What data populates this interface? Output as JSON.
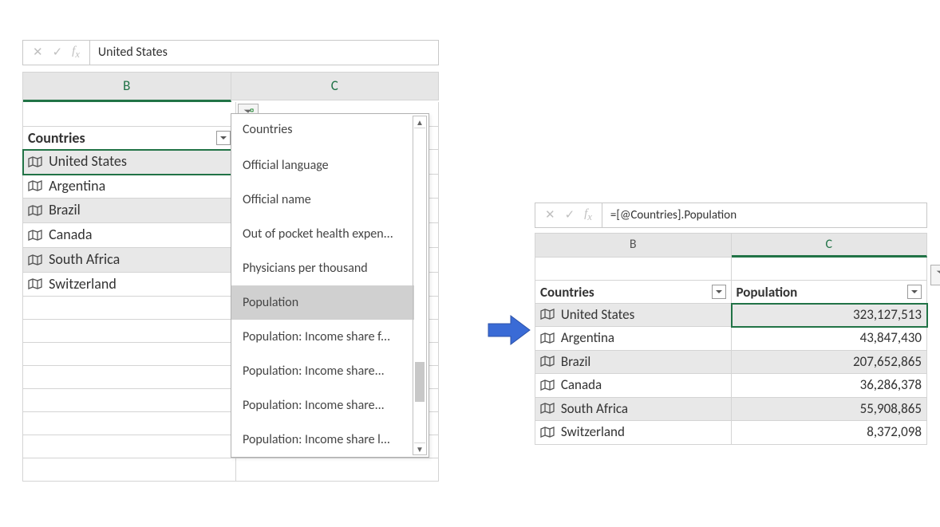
{
  "left": {
    "formula_value": "United States",
    "columns": {
      "b": "B",
      "c": "C"
    },
    "table_header": "Countries",
    "countries": [
      "United States",
      "Argentina",
      "Brazil",
      "Canada",
      "South Africa",
      "Switzerland"
    ],
    "dropdown": {
      "items": [
        "Countries",
        "Official language",
        "Official name",
        "Out of pocket health expen...",
        "Physicians per thousand",
        "Population",
        "Population: Income share f...",
        "Population: Income share...",
        "Population: Income share...",
        "Population: Income share l..."
      ],
      "selected_index": 5
    }
  },
  "right": {
    "formula_value": "=[@Countries].Population",
    "columns": {
      "b": "B",
      "c": "C"
    },
    "headers": {
      "countries": "Countries",
      "population": "Population"
    },
    "rows": [
      {
        "country": "United States",
        "population": "323,127,513"
      },
      {
        "country": "Argentina",
        "population": "43,847,430"
      },
      {
        "country": "Brazil",
        "population": "207,652,865"
      },
      {
        "country": "Canada",
        "population": "36,286,378"
      },
      {
        "country": "South Africa",
        "population": "55,908,865"
      },
      {
        "country": "Switzerland",
        "population": "8,372,098"
      }
    ]
  }
}
